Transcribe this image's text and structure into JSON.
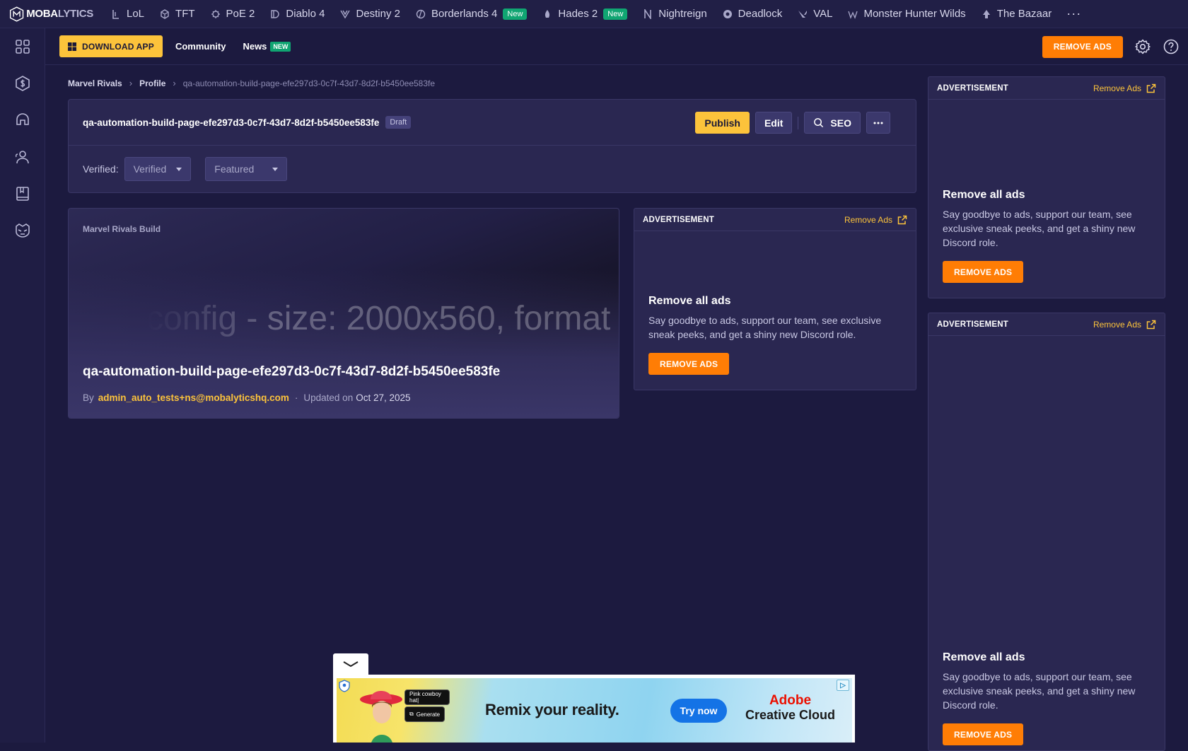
{
  "topnav": {
    "logo_brand": "MOBA",
    "logo_suffix": "LYTICS",
    "games": [
      {
        "label": "LoL",
        "icon": "lol-icon"
      },
      {
        "label": "TFT",
        "icon": "tft-icon"
      },
      {
        "label": "PoE 2",
        "icon": "poe2-icon"
      },
      {
        "label": "Diablo 4",
        "icon": "diablo4-icon"
      },
      {
        "label": "Destiny 2",
        "icon": "destiny2-icon"
      },
      {
        "label": "Borderlands 4",
        "icon": "borderlands4-icon",
        "badge": "New"
      },
      {
        "label": "Hades 2",
        "icon": "hades2-icon",
        "badge": "New"
      },
      {
        "label": "Nightreign",
        "icon": "nightreign-icon"
      },
      {
        "label": "Deadlock",
        "icon": "deadlock-icon"
      },
      {
        "label": "VAL",
        "icon": "valorant-icon"
      },
      {
        "label": "Monster Hunter Wilds",
        "icon": "monster-hunter-icon"
      },
      {
        "label": "The Bazaar",
        "icon": "bazaar-icon"
      }
    ],
    "more": "···"
  },
  "sidebar": {
    "icons": [
      "grid-icon",
      "coin-icon",
      "helmet-icon",
      "users-icon",
      "book-icon",
      "marvel-mask-icon"
    ]
  },
  "subheader": {
    "download_label": "DOWNLOAD APP",
    "community_label": "Community",
    "news_label": "News",
    "news_badge": "NEW",
    "remove_ads_label": "REMOVE ADS"
  },
  "breadcrumb": {
    "items": [
      "Marvel Rivals",
      "Profile"
    ],
    "current": "qa-automation-build-page-efe297d3-0c7f-43d7-8d2f-b5450ee583fe"
  },
  "header_card": {
    "title": "qa-automation-build-page-efe297d3-0c7f-43d7-8d2f-b5450ee583fe",
    "status": "Draft",
    "publish_label": "Publish",
    "edit_label": "Edit",
    "seo_label": "SEO",
    "verified_label": "Verified:",
    "verified_value": "Verified",
    "featured_value": "Featured"
  },
  "build_card": {
    "kicker": "Marvel Rivals Build",
    "background_text": "config - size: 2000x560, format",
    "title": "qa-automation-build-page-efe297d3-0c7f-43d7-8d2f-b5450ee583fe",
    "by_label": "By",
    "author": "admin_auto_tests+ns@mobalyticshq.com",
    "separator": "·",
    "updated_label": "Updated on",
    "updated_date": "Oct 27, 2025"
  },
  "ads": {
    "label": "ADVERTISEMENT",
    "remove_link": "Remove Ads",
    "heading": "Remove all ads",
    "body": "Say goodbye to ads, support our team, see exclusive sneak peeks, and get a shiny new Discord role.",
    "button": "REMOVE ADS"
  },
  "banner": {
    "headline": "Remix your reality.",
    "cta": "Try now",
    "brand_line1": "Adobe",
    "brand_line2": "Creative Cloud",
    "chip_prompt": "Pink cowboy hat|",
    "chip_generate": "Generate",
    "ad_choice": "▷"
  },
  "colors": {
    "background": "#1c1a3f",
    "accent_yellow": "#fcc33b",
    "accent_orange": "#ff7d05",
    "badge_green": "#10a572"
  }
}
